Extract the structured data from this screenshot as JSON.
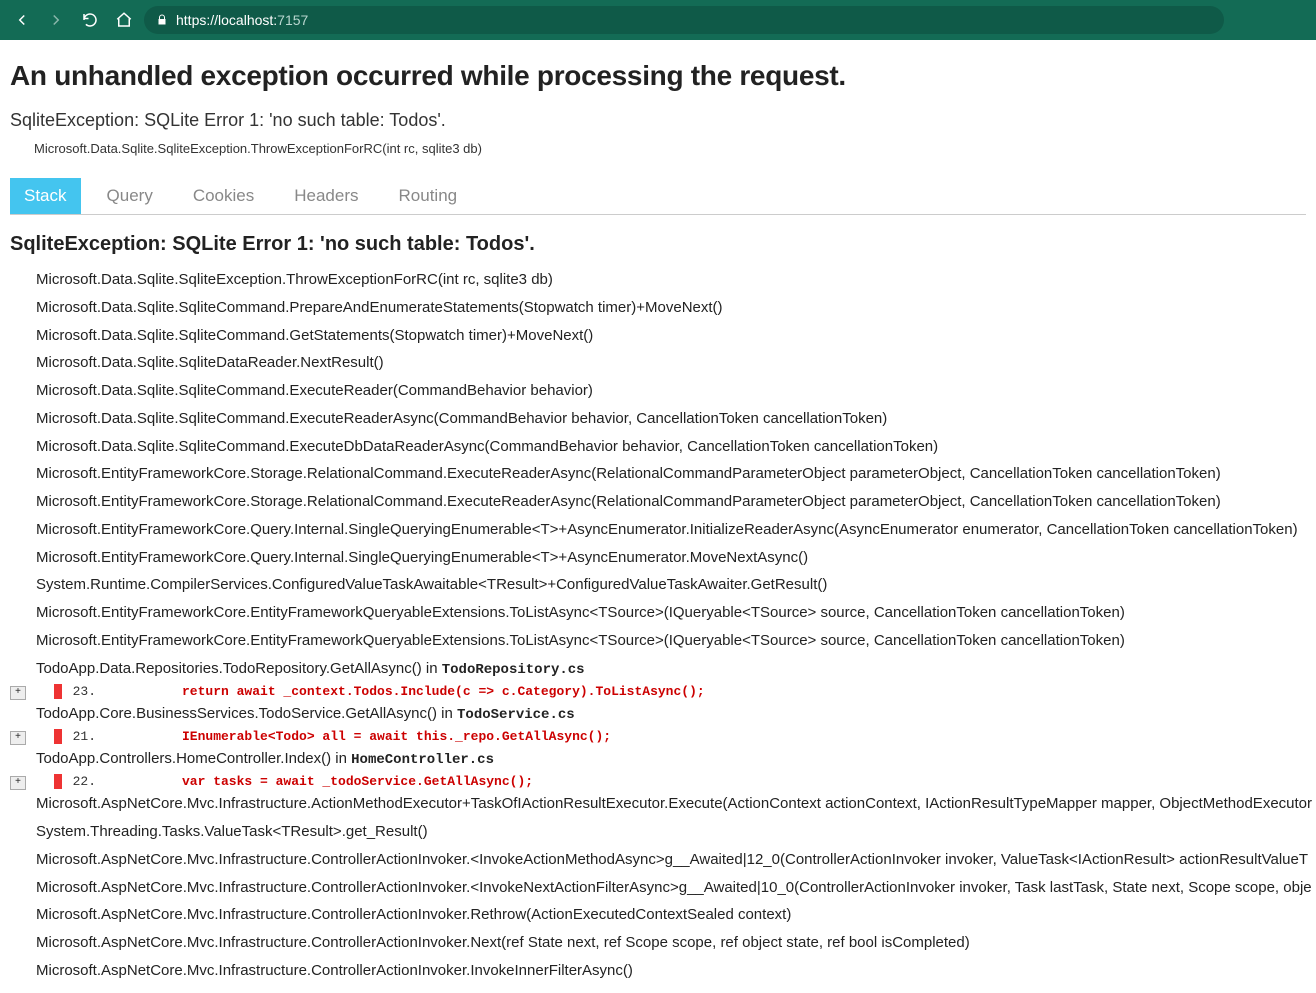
{
  "browser": {
    "url_scheme_host": "https://localhost:",
    "url_port": "7157"
  },
  "page_title": "An unhandled exception occurred while processing the request.",
  "exception_summary": "SqliteException: SQLite Error 1: 'no such table: Todos'.",
  "summary_source": "Microsoft.Data.Sqlite.SqliteException.ThrowExceptionForRC(int rc, sqlite3 db)",
  "tabs": [
    "Stack",
    "Query",
    "Cookies",
    "Headers",
    "Routing"
  ],
  "active_tab": 0,
  "stack_heading": "SqliteException: SQLite Error 1: 'no such table: Todos'.",
  "frames": [
    {
      "text": "Microsoft.Data.Sqlite.SqliteException.ThrowExceptionForRC(int rc, sqlite3 db)"
    },
    {
      "text": "Microsoft.Data.Sqlite.SqliteCommand.PrepareAndEnumerateStatements(Stopwatch timer)+MoveNext()"
    },
    {
      "text": "Microsoft.Data.Sqlite.SqliteCommand.GetStatements(Stopwatch timer)+MoveNext()"
    },
    {
      "text": "Microsoft.Data.Sqlite.SqliteDataReader.NextResult()"
    },
    {
      "text": "Microsoft.Data.Sqlite.SqliteCommand.ExecuteReader(CommandBehavior behavior)"
    },
    {
      "text": "Microsoft.Data.Sqlite.SqliteCommand.ExecuteReaderAsync(CommandBehavior behavior, CancellationToken cancellationToken)"
    },
    {
      "text": "Microsoft.Data.Sqlite.SqliteCommand.ExecuteDbDataReaderAsync(CommandBehavior behavior, CancellationToken cancellationToken)"
    },
    {
      "text": "Microsoft.EntityFrameworkCore.Storage.RelationalCommand.ExecuteReaderAsync(RelationalCommandParameterObject parameterObject, CancellationToken cancellationToken)"
    },
    {
      "text": "Microsoft.EntityFrameworkCore.Storage.RelationalCommand.ExecuteReaderAsync(RelationalCommandParameterObject parameterObject, CancellationToken cancellationToken)"
    },
    {
      "text": "Microsoft.EntityFrameworkCore.Query.Internal.SingleQueryingEnumerable<T>+AsyncEnumerator.InitializeReaderAsync(AsyncEnumerator enumerator, CancellationToken cancellationToken)"
    },
    {
      "text": "Microsoft.EntityFrameworkCore.Query.Internal.SingleQueryingEnumerable<T>+AsyncEnumerator.MoveNextAsync()"
    },
    {
      "text": "System.Runtime.CompilerServices.ConfiguredValueTaskAwaitable<TResult>+ConfiguredValueTaskAwaiter.GetResult()"
    },
    {
      "text": "Microsoft.EntityFrameworkCore.EntityFrameworkQueryableExtensions.ToListAsync<TSource>(IQueryable<TSource> source, CancellationToken cancellationToken)"
    },
    {
      "text": "Microsoft.EntityFrameworkCore.EntityFrameworkQueryableExtensions.ToListAsync<TSource>(IQueryable<TSource> source, CancellationToken cancellationToken)"
    },
    {
      "text": "TodoApp.Data.Repositories.TodoRepository.GetAllAsync() in ",
      "srcfile": "TodoRepository.cs",
      "codeline": {
        "lineno": "23.",
        "code": "return await _context.Todos.Include(c => c.Category).ToListAsync();"
      }
    },
    {
      "text": "TodoApp.Core.BusinessServices.TodoService.GetAllAsync() in ",
      "srcfile": "TodoService.cs",
      "codeline": {
        "lineno": "21.",
        "code": "IEnumerable<Todo> all = await this._repo.GetAllAsync();"
      }
    },
    {
      "text": "TodoApp.Controllers.HomeController.Index() in ",
      "srcfile": "HomeController.cs",
      "codeline": {
        "lineno": "22.",
        "code": "var tasks = await _todoService.GetAllAsync();"
      }
    },
    {
      "text": "Microsoft.AspNetCore.Mvc.Infrastructure.ActionMethodExecutor+TaskOfIActionResultExecutor.Execute(ActionContext actionContext, IActionResultTypeMapper mapper, ObjectMethodExecutor"
    },
    {
      "text": "System.Threading.Tasks.ValueTask<TResult>.get_Result()"
    },
    {
      "text": "Microsoft.AspNetCore.Mvc.Infrastructure.ControllerActionInvoker.<InvokeActionMethodAsync>g__Awaited|12_0(ControllerActionInvoker invoker, ValueTask<IActionResult> actionResultValueT"
    },
    {
      "text": "Microsoft.AspNetCore.Mvc.Infrastructure.ControllerActionInvoker.<InvokeNextActionFilterAsync>g__Awaited|10_0(ControllerActionInvoker invoker, Task lastTask, State next, Scope scope, obje"
    },
    {
      "text": "Microsoft.AspNetCore.Mvc.Infrastructure.ControllerActionInvoker.Rethrow(ActionExecutedContextSealed context)"
    },
    {
      "text": "Microsoft.AspNetCore.Mvc.Infrastructure.ControllerActionInvoker.Next(ref State next, ref Scope scope, ref object state, ref bool isCompleted)"
    },
    {
      "text": "Microsoft.AspNetCore.Mvc.Infrastructure.ControllerActionInvoker.InvokeInnerFilterAsync()"
    }
  ]
}
